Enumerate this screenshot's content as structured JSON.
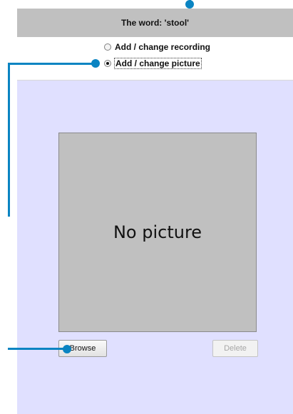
{
  "header": {
    "title": "The word: 'stool'"
  },
  "options": {
    "recording_label": "Add / change recording",
    "picture_label": "Add / change picture",
    "selected": "picture"
  },
  "picture": {
    "placeholder": "No picture"
  },
  "buttons": {
    "browse_label": "Browse",
    "delete_label": "Delete"
  },
  "colors": {
    "header_bg": "#c0c0c0",
    "content_bg": "#e0e0ff",
    "callout": "#0a84c2"
  }
}
